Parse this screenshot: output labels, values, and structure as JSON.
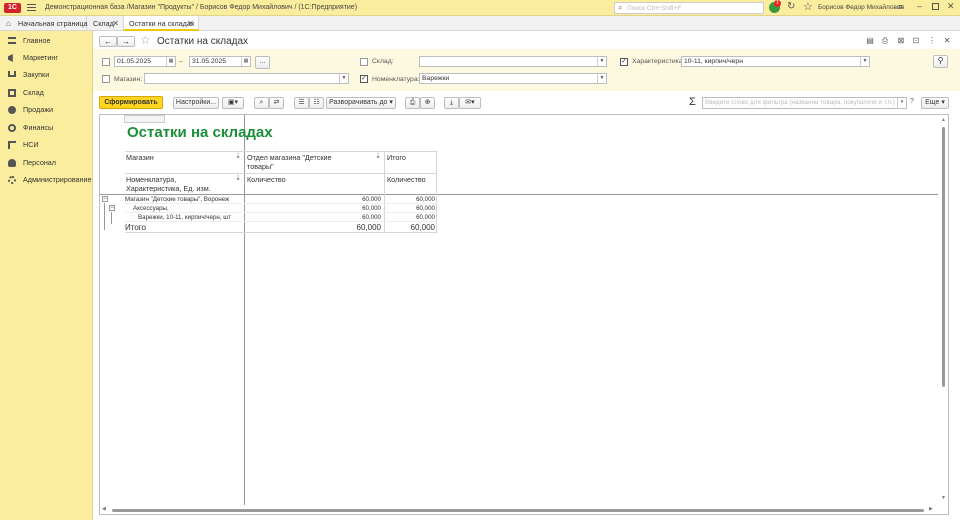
{
  "titlebar": {
    "title": "Демонстрационная база /Магазин \"Продукты\" / Борисов Федор Михайлович /  (1С:Предприятие)",
    "search_placeholder": "Поиск Ctrl+Shift+F",
    "user": "Борисов Федор Михайлович",
    "notification_count": "1"
  },
  "tabs": [
    {
      "label": "Начальная страница"
    },
    {
      "label": "Склад"
    },
    {
      "label": "Остатки на складах"
    }
  ],
  "sidebar": {
    "items": [
      {
        "label": "Главное",
        "icon": "menu-icon"
      },
      {
        "label": "Маркетинг",
        "icon": "megaphone-icon"
      },
      {
        "label": "Закупки",
        "icon": "cart-icon"
      },
      {
        "label": "Склад",
        "icon": "box-icon"
      },
      {
        "label": "Продажи",
        "icon": "sales-icon"
      },
      {
        "label": "Финансы",
        "icon": "coin-icon"
      },
      {
        "label": "НСИ",
        "icon": "list-icon"
      },
      {
        "label": "Персонал",
        "icon": "person-icon"
      },
      {
        "label": "Администрирование",
        "icon": "gear-icon"
      }
    ]
  },
  "form": {
    "title": "Остатки на складах",
    "date_from": "01.05.2025",
    "date_separator": "–",
    "date_to": "31.05.2025",
    "period_button": "...",
    "warehouse_label": "Склад:",
    "warehouse_value": "",
    "characteristic_label": "Характеристика:",
    "characteristic_value": "10-11, кирпич/черн",
    "store_label": "Магазин:",
    "store_value": "",
    "nomenclature_label": "Номенклатура:",
    "nomenclature_value": "Варежки"
  },
  "toolbar": {
    "generate_label": "Сформировать",
    "settings_label": "Настройки...",
    "expand_label": "Разворачивать до",
    "filter_placeholder": "Введите слово для фильтра (название товара, покупателя и т.п.)",
    "help_label": "?",
    "more_label": "Еще"
  },
  "report": {
    "title": "Остатки на складах",
    "header": {
      "store": "Магазин",
      "dept_line1": "Отдел магазина \"Детские",
      "dept_line2": "товары\"",
      "total": "Итого",
      "nom_line1": "Номенклатура,",
      "nom_line2": "Характеристика, Ед. изм.",
      "qty1": "Количество",
      "qty2": "Количество"
    },
    "rows": [
      {
        "label": "Магазин \"Детские товары\", Воронеж",
        "v1": "60,000",
        "v2": "60,000"
      },
      {
        "label": "Аксессуары,",
        "v1": "60,000",
        "v2": "60,000"
      },
      {
        "label": "Варежки, 10-11, кирпич/черн, шт",
        "v1": "60,000",
        "v2": "60,000"
      }
    ],
    "total": {
      "label": "Итого",
      "v1": "60,000",
      "v2": "60,000"
    }
  },
  "colors": {
    "accent": "#fbed9e",
    "generate": "#ffd51e",
    "report_title": "#1b8f3a"
  }
}
